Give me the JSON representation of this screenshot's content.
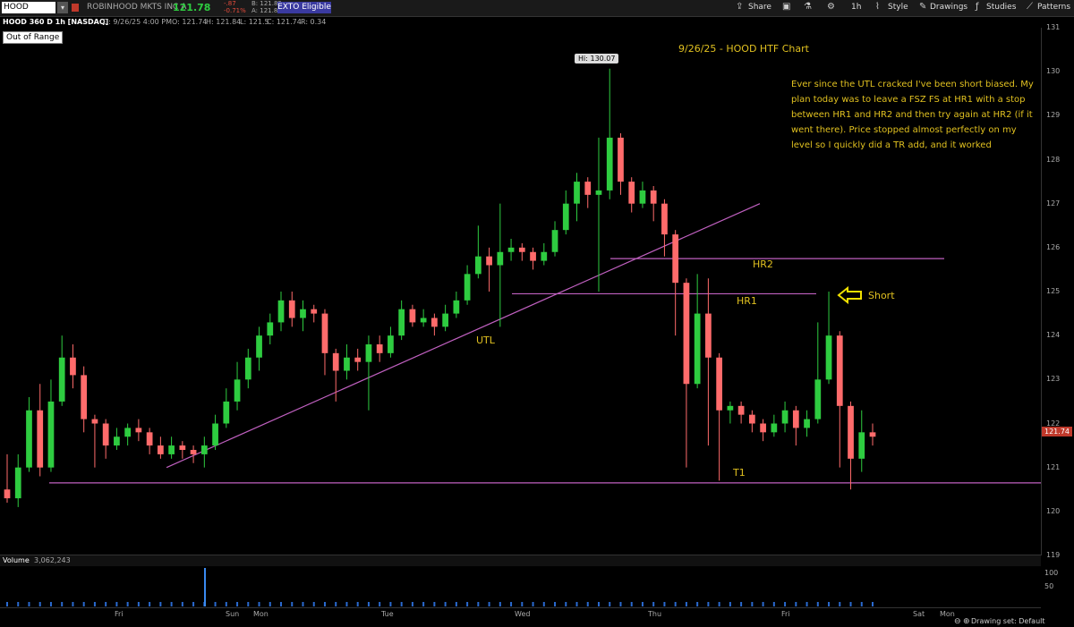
{
  "toolbar": {
    "symbol": "HOOD",
    "company": "ROBINHOOD MKTS INC A",
    "last": "121.78",
    "change": "-.87",
    "change_pct": "-0.71%",
    "bid": "B: 121.82",
    "ask": "A: 121.84",
    "exto": "EXTO Eligible",
    "share": "Share",
    "timeframe": "1h",
    "style": "Style",
    "drawings": "Drawings",
    "studies": "Studies",
    "patterns": "Patterns"
  },
  "info": {
    "title": "HOOD 360 D 1h [NASDAQ]",
    "date": "D: 9/26/25 4:00 PM",
    "open": "O: 121.74",
    "high": "H: 121.84",
    "low": "L: 121.5",
    "close": "C: 121.74",
    "range": "R: 0.34"
  },
  "out_of_range": "Out of Range",
  "annotations": {
    "title": "9/26/25 - HOOD HTF Chart",
    "note": "Ever since the UTL cracked I've been short biased. My plan today was to leave a FSZ FS at HR1 with a stop between HR1 and HR2 and then try again at HR2 (if it went there). Price stopped almost perfectly on my level so I quickly did a TR add, and it worked",
    "utl": "UTL",
    "hr1": "HR1",
    "hr2": "HR2",
    "t1": "T1",
    "short": "Short",
    "hi": "Hi: 130.07"
  },
  "price_tag": "121.74",
  "volume": {
    "label": "Volume",
    "value": "3,062,243",
    "ticks": [
      "100",
      "50"
    ]
  },
  "drawing_set": "Drawing set: Default",
  "colors": {
    "up": "#2ecc40",
    "down": "#ff6b6b",
    "line": "#c060c0",
    "ann": "#e0c020"
  },
  "chart_data": {
    "type": "candlestick",
    "ylim": [
      119,
      131
    ],
    "y_ticks": [
      "131",
      "130",
      "129",
      "128",
      "127",
      "126",
      "125",
      "124",
      "123",
      "122",
      "121",
      "120",
      "119"
    ],
    "x_ticks": [
      "Fri",
      "Sun",
      "Mon",
      "Tue",
      "Wed",
      "Thu",
      "Fri",
      "Sat",
      "Mon"
    ],
    "candles": [
      [
        120.5,
        120.3,
        121.3,
        120.2
      ],
      [
        120.3,
        121.0,
        121.3,
        120.1
      ],
      [
        121.0,
        122.3,
        122.6,
        120.9
      ],
      [
        122.3,
        121.0,
        122.9,
        120.8
      ],
      [
        121.0,
        122.5,
        123.0,
        120.9
      ],
      [
        122.5,
        123.5,
        124.0,
        122.4
      ],
      [
        123.5,
        123.1,
        123.8,
        122.8
      ],
      [
        123.1,
        122.1,
        123.3,
        121.8
      ],
      [
        122.1,
        122.0,
        122.2,
        121.0
      ],
      [
        122.0,
        121.5,
        122.1,
        121.2
      ],
      [
        121.5,
        121.7,
        121.9,
        121.4
      ],
      [
        121.7,
        121.9,
        122.0,
        121.5
      ],
      [
        121.9,
        121.8,
        122.1,
        121.6
      ],
      [
        121.8,
        121.5,
        121.9,
        121.3
      ],
      [
        121.5,
        121.3,
        121.7,
        121.2
      ],
      [
        121.3,
        121.5,
        121.7,
        121.2
      ],
      [
        121.5,
        121.4,
        121.6,
        121.2
      ],
      [
        121.4,
        121.3,
        121.5,
        121.1
      ],
      [
        121.3,
        121.5,
        121.7,
        121.0
      ],
      [
        121.5,
        122.0,
        122.2,
        121.4
      ],
      [
        122.0,
        122.5,
        122.8,
        121.9
      ],
      [
        122.5,
        123.0,
        123.4,
        122.3
      ],
      [
        123.0,
        123.5,
        123.7,
        122.8
      ],
      [
        123.5,
        124.0,
        124.2,
        123.2
      ],
      [
        124.0,
        124.3,
        124.5,
        123.8
      ],
      [
        124.3,
        124.8,
        125.0,
        124.1
      ],
      [
        124.8,
        124.4,
        125.0,
        124.2
      ],
      [
        124.4,
        124.6,
        124.8,
        124.1
      ],
      [
        124.6,
        124.5,
        124.7,
        124.3
      ],
      [
        124.5,
        123.6,
        124.6,
        123.1
      ],
      [
        123.6,
        123.2,
        123.7,
        122.5
      ],
      [
        123.2,
        123.5,
        123.8,
        123.0
      ],
      [
        123.5,
        123.4,
        123.7,
        123.2
      ],
      [
        123.4,
        123.8,
        124.0,
        122.3
      ],
      [
        123.8,
        123.6,
        124.0,
        123.4
      ],
      [
        123.6,
        124.0,
        124.2,
        123.5
      ],
      [
        124.0,
        124.6,
        124.8,
        123.9
      ],
      [
        124.6,
        124.3,
        124.7,
        124.2
      ],
      [
        124.3,
        124.4,
        124.6,
        124.2
      ],
      [
        124.4,
        124.2,
        124.5,
        124.0
      ],
      [
        124.2,
        124.5,
        124.7,
        124.1
      ],
      [
        124.5,
        124.8,
        125.0,
        124.4
      ],
      [
        124.8,
        125.4,
        125.6,
        124.7
      ],
      [
        125.4,
        125.8,
        126.5,
        125.3
      ],
      [
        125.8,
        125.6,
        126.0,
        125.0
      ],
      [
        125.6,
        125.9,
        127.0,
        124.2
      ],
      [
        125.9,
        126.0,
        126.2,
        125.7
      ],
      [
        126.0,
        125.9,
        126.1,
        125.7
      ],
      [
        125.9,
        125.7,
        126.0,
        125.5
      ],
      [
        125.7,
        125.9,
        126.1,
        125.6
      ],
      [
        125.9,
        126.4,
        126.6,
        125.8
      ],
      [
        126.4,
        127.0,
        127.3,
        126.3
      ],
      [
        127.0,
        127.5,
        127.7,
        126.6
      ],
      [
        127.5,
        127.2,
        127.6,
        126.9
      ],
      [
        127.2,
        127.3,
        128.5,
        125.0
      ],
      [
        127.3,
        128.5,
        130.07,
        127.1
      ],
      [
        128.5,
        127.5,
        128.6,
        127.2
      ],
      [
        127.5,
        127.0,
        127.6,
        126.8
      ],
      [
        127.0,
        127.3,
        127.5,
        126.9
      ],
      [
        127.3,
        127.0,
        127.4,
        126.6
      ],
      [
        127.0,
        126.3,
        127.1,
        125.8
      ],
      [
        126.3,
        125.2,
        126.4,
        124.0
      ],
      [
        125.2,
        122.9,
        125.3,
        121.0
      ],
      [
        122.9,
        124.5,
        125.4,
        122.8
      ],
      [
        124.5,
        123.5,
        125.3,
        121.5
      ],
      [
        123.5,
        122.3,
        123.6,
        120.7
      ],
      [
        122.3,
        122.4,
        122.5,
        122.0
      ],
      [
        122.4,
        122.2,
        122.5,
        122.0
      ],
      [
        122.2,
        122.0,
        122.3,
        121.8
      ],
      [
        122.0,
        121.8,
        122.1,
        121.6
      ],
      [
        121.8,
        122.0,
        122.2,
        121.7
      ],
      [
        122.0,
        122.3,
        122.5,
        121.8
      ],
      [
        122.3,
        121.9,
        122.4,
        121.5
      ],
      [
        121.9,
        122.1,
        122.3,
        121.7
      ],
      [
        122.1,
        123.0,
        124.3,
        122.0
      ],
      [
        123.0,
        124.0,
        125.0,
        122.9
      ],
      [
        124.0,
        122.4,
        124.1,
        121.0
      ],
      [
        122.4,
        121.2,
        122.5,
        120.5
      ],
      [
        121.2,
        121.8,
        122.3,
        120.9
      ],
      [
        121.8,
        121.7,
        122.0,
        121.5
      ]
    ],
    "levels": {
      "HR2": 125.75,
      "HR1": 124.95,
      "T1": 120.65
    },
    "utl": [
      [
        121.0,
        0.16
      ],
      [
        127.0,
        0.73
      ]
    ],
    "volume_spike": 100
  }
}
